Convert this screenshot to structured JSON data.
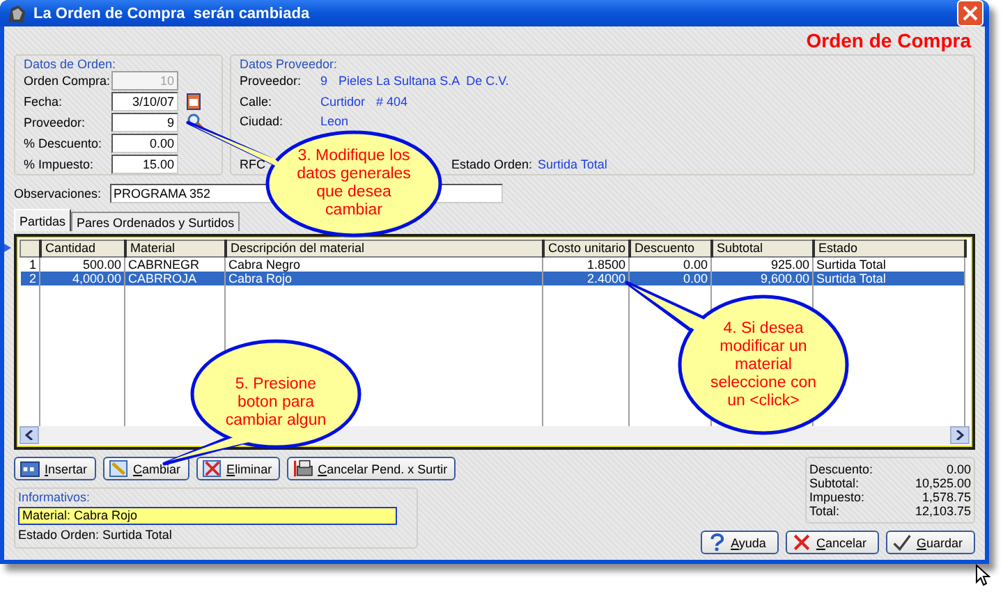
{
  "window": {
    "title": "La Orden de Compra  serán cambiada"
  },
  "header_title": "Orden de Compra",
  "datos_orden": {
    "label": "Datos de Orden:",
    "fields": [
      {
        "label": "Orden Compra:",
        "value": "10",
        "kind": "text",
        "disabled": true
      },
      {
        "label": "Fecha:",
        "value": "3/10/07",
        "kind": "date",
        "disabled": false
      },
      {
        "label": "Proveedor:",
        "value": "9",
        "kind": "lookup",
        "disabled": false
      },
      {
        "label": "% Descuento:",
        "value": "0.00",
        "kind": "text",
        "disabled": false
      },
      {
        "label": "% Impuesto:",
        "value": "15.00",
        "kind": "text",
        "disabled": false
      }
    ]
  },
  "datos_proveedor": {
    "label": "Datos Proveedor:",
    "rows": [
      {
        "label": "Proveedor:",
        "values": [
          "9",
          "Pieles La Sultana S.A  De C.V."
        ]
      },
      {
        "label": "Calle:",
        "values": [
          "Curtidor",
          "# 404"
        ]
      },
      {
        "label": "Ciudad:",
        "values": [
          "Leon"
        ]
      },
      {
        "label": "RFC",
        "values": []
      }
    ],
    "estado": {
      "label": "Estado Orden:",
      "value": "Surtida Total"
    }
  },
  "observaciones": {
    "label": "Observaciones:",
    "value": "PROGRAMA 352"
  },
  "tabs": [
    {
      "label": "Partidas",
      "selected": true
    },
    {
      "label": "Pares Ordenados y Surtidos",
      "selected": false
    }
  ],
  "table": {
    "columns": [
      "Cantidad",
      "Material",
      "Descripción del material",
      "Costo unitario",
      "Descuento",
      "Subtotal",
      "Estado"
    ],
    "rows": [
      {
        "number": "1",
        "cells": [
          "500.00",
          "CABRNEGR",
          "Cabra Negro",
          "1.8500",
          "0.00",
          "925.00",
          "Surtida Total"
        ],
        "selected": false
      },
      {
        "number": "2",
        "cells": [
          "4,000.00",
          "CABRROJA",
          "Cabra Rojo",
          "2.4000",
          "0.00",
          "9,600.00",
          "Surtida Total"
        ],
        "selected": true
      }
    ]
  },
  "row_buttons": [
    {
      "label": "Insertar",
      "kind": "insert"
    },
    {
      "label": "Cambiar",
      "kind": "edit"
    },
    {
      "label": "Eliminar",
      "kind": "delete"
    },
    {
      "label": "Cancelar Pend. x Surtir",
      "kind": "cancel-pending"
    }
  ],
  "informativos": {
    "label": "Informativos:",
    "material": "Material: Cabra Rojo",
    "estado": "Estado Orden: Surtida Total"
  },
  "totals": [
    {
      "label": "Descuento:",
      "value": "0.00"
    },
    {
      "label": "Subtotal:",
      "value": "10,525.00"
    },
    {
      "label": "Impuesto:",
      "value": "1,578.75"
    },
    {
      "label": "Total:",
      "value": "12,103.75"
    }
  ],
  "dialog_buttons": [
    {
      "label": "Ayuda",
      "kind": "help"
    },
    {
      "label": "Cancelar",
      "kind": "cancel"
    },
    {
      "label": "Guardar",
      "kind": "save"
    }
  ],
  "callouts": [
    {
      "lines": [
        "3. Modifique los",
        "datos generales",
        "que desea",
        "cambiar"
      ]
    },
    {
      "lines": [
        "4. Si desea",
        "modificar un",
        "material",
        "seleccione con",
        "un <click>"
      ]
    },
    {
      "lines": [
        "5. Presione",
        "boton para",
        "cambiar algun"
      ]
    }
  ]
}
